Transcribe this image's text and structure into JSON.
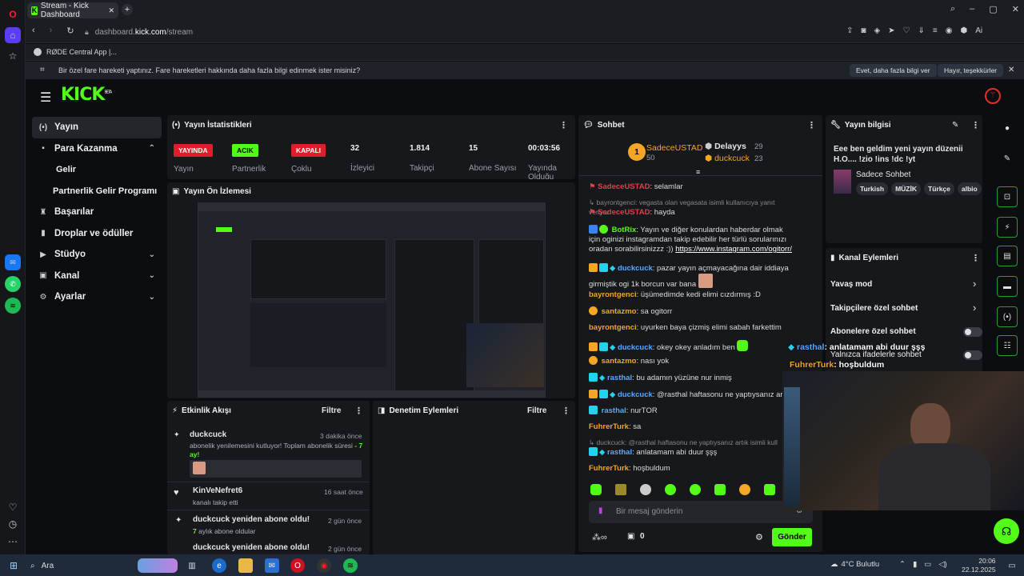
{
  "browser": {
    "tab_title": "Stream - Kick Dashboard",
    "url_prefix": "dashboard.",
    "url_domain": "kick.com",
    "url_path": "/stream",
    "bookmark": "RØDE Central App |...",
    "notification": "Bir özel fare hareketi yaptınız. Fare hareketleri hakkında daha fazla bilgi edinmek ister misiniz?",
    "notif_yes": "Evet, daha fazla bilgi ver",
    "notif_no": "Hayır, teşekkürler"
  },
  "kick": {
    "logo": "KICK",
    "logo_sup": "BETA"
  },
  "nav": [
    {
      "label": "Yayın",
      "icon": "(•)"
    },
    {
      "label": "Para Kazanma",
      "icon": "▪",
      "chev": "⌃"
    },
    {
      "label": "Gelir",
      "sub": true
    },
    {
      "label": "Partnerlik Gelir Programı",
      "sub": true
    },
    {
      "label": "Başarılar",
      "icon": "♜"
    },
    {
      "label": "Droplar ve ödüller",
      "icon": "▮"
    },
    {
      "label": "Stüdyo",
      "icon": "▶",
      "chev": "⌄"
    },
    {
      "label": "Kanal",
      "icon": "▣",
      "chev": "⌄"
    },
    {
      "label": "Ayarlar",
      "icon": "⚙",
      "chev": "⌄"
    }
  ],
  "stats": {
    "title": "Yayın İstatistikleri",
    "items": [
      {
        "badge": "YAYINDA",
        "label": "Yayın",
        "color": "#e01e2b",
        "text": "#fff"
      },
      {
        "badge": "ACIK",
        "label": "Partnerlik",
        "color": "#53fc18",
        "text": "#000"
      },
      {
        "badge": "KAPALI",
        "label": "Çoklu",
        "color": "#e01e2b",
        "text": "#fff"
      },
      {
        "value": "32",
        "label": "İzleyici"
      },
      {
        "value": "1.814",
        "label": "Takipçi"
      },
      {
        "value": "15",
        "label": "Abone Sayısı"
      },
      {
        "value": "00:03:56",
        "label": "Yayında Olduğu"
      }
    ]
  },
  "preview": {
    "title": "Yayın Ön İzlemesi"
  },
  "events": {
    "title": "Etkinlik Akışı",
    "filter": "Filtre",
    "items": [
      {
        "user": "duckcuck",
        "time": "3 dakika önce",
        "text": "abonelik yenilemesini kutluyor! Toplam abonelik süresi",
        "highlight": "- 7 ay!"
      },
      {
        "user": "KinVeNefret6",
        "time": "16 saat önce",
        "text": "kanalı takip etti"
      },
      {
        "user": "duckcuck yeniden abone oldu!",
        "time": "2 gün önce",
        "text": "aylık abone oldular",
        "highlight": "7"
      },
      {
        "user": "duckcuck yeniden abone oldu!",
        "time": "2 gün önce"
      }
    ]
  },
  "moderation": {
    "title": "Denetim Eylemleri",
    "filter": "Filtre"
  },
  "chat": {
    "title": "Sohbet",
    "top": [
      {
        "name": "SadeceUSTAD",
        "count": "50",
        "rank": "1"
      },
      {
        "name": "Delayys",
        "count": "29"
      },
      {
        "name": "duckcuck",
        "count": "23"
      }
    ],
    "messages": [
      {
        "user": "SadeceUSTAD",
        "text": ": selamlar",
        "color": "#e0404a"
      },
      {
        "reply": "bayrontgenci: vegasta olan vegasata isimli kullanıcıya yanıt veriyor"
      },
      {
        "user": "SadeceUSTAD",
        "text": ": hayda",
        "color": "#e0404a"
      },
      {
        "user": "BotRix",
        "text": ": Yayın ve diğer konulardan haberdar olmak için oginizi instagramdan takip edebilir her türlü sorularınızı oradan sorabilirsinizzz :)) ",
        "link": "https://www.instagram.com/ogitorr/",
        "color": "#53fc18"
      },
      {
        "user": "duckcuck",
        "text": ": pazar yayın açmayacağına dair iddiaya girmiştik ogi 1k borcun var bana",
        "color": "#5aa9ff"
      },
      {
        "user": "bayrontgenci",
        "text": ": üşümedimde kedi elimi cızdırmış :D",
        "color": "#f5a623"
      },
      {
        "user": "santazmo",
        "text": ": sa ogitorr",
        "color": "#f5a623"
      },
      {
        "user": "bayrontgenci",
        "text": ": uyurken baya çizmiş elimi sabah farkettim",
        "color": "#f5a623"
      },
      {
        "user": "duckcuck",
        "text": ": okey okey anladım ben",
        "color": "#5aa9ff"
      },
      {
        "user": "santazmo",
        "text": ": nası yok",
        "color": "#f5a623"
      },
      {
        "user": "rasthal",
        "text": ": bu adamın yüzüne nur inmiş",
        "color": "#5aa9ff"
      },
      {
        "user": "duckcuck",
        "text": ": @rasthal haftasonu ne yaptıysanız ar",
        "color": "#5aa9ff"
      },
      {
        "user": "rasthal",
        "text": ": nurTOR",
        "color": "#5aa9ff"
      },
      {
        "user": "FuhrerTurk",
        "text": ": sa",
        "color": "#f5a623"
      },
      {
        "reply": "duckcuck: @rasthal haftasonu ne yaptıysanız artık isimli kull"
      },
      {
        "user": "rasthal",
        "text": ": anlatamam abi duur şşş",
        "color": "#5aa9ff"
      },
      {
        "user": "FuhrerTurk",
        "text": ": hoşbuldum",
        "color": "#f5a623"
      }
    ],
    "placeholder": "Bir mesaj gönderin",
    "send": "Gönder",
    "points": "0"
  },
  "info": {
    "title": "Yayın bilgisi",
    "stream_title": "Eee ben geldim yeni yayın düzenii H.O.... !zio !ins !dc !yt",
    "category": "Sadece Sohbet",
    "tags": [
      "Turkish",
      "MÜZİK",
      "Türkçe",
      "albio"
    ]
  },
  "actions": {
    "title": "Kanal Eylemleri",
    "items": [
      "Yavaş mod",
      "Takipçilere özel sohbet",
      "Abonelere özel sohbet",
      "Yalnızca ifadelerle sohbet"
    ]
  },
  "overlay": {
    "line1_user": "rasthal",
    "line1_text": ": anlatamam abi duur şşş",
    "line2_user": "FuhrerTurk",
    "line2_text": ": hoşbuldum"
  },
  "taskbar": {
    "search": "Ara",
    "weather": "4°C Bulutlu",
    "time": "20:06",
    "date": "22.12.2025"
  }
}
